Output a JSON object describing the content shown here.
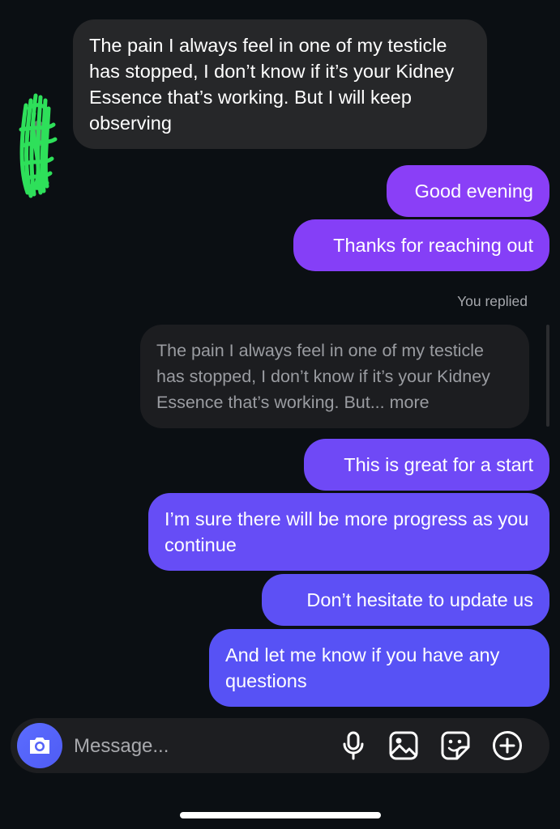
{
  "thread": {
    "incoming_message": "The pain I always feel in one of my testicle has stopped, I don’t know if it’s your Kidney Essence that’s working. But I will keep observing",
    "outgoing_1": "Good evening",
    "outgoing_2": "Thanks for reaching out",
    "replied_label": "You replied",
    "quoted_reply": "The pain I always feel in one of my testicle has stopped, I don’t know if it’s your Kidney Essence that’s working. But... more",
    "outgoing_3": "This is great for a start",
    "outgoing_4": "I’m sure there will be more progress as you continue",
    "outgoing_5": "Don’t hesitate to update us",
    "outgoing_6": "And let me know if you have any questions"
  },
  "composer": {
    "placeholder": "Message...",
    "icons": [
      "camera-icon",
      "microphone-icon",
      "image-icon",
      "sticker-icon",
      "plus-circle-icon"
    ]
  },
  "colors": {
    "background": "#0b0f13",
    "incoming_bubble": "#262729",
    "outgoing_gradient_top": "#8a3ff7",
    "outgoing_gradient_bottom": "#5751f5",
    "camera_button": "#5563f8"
  }
}
